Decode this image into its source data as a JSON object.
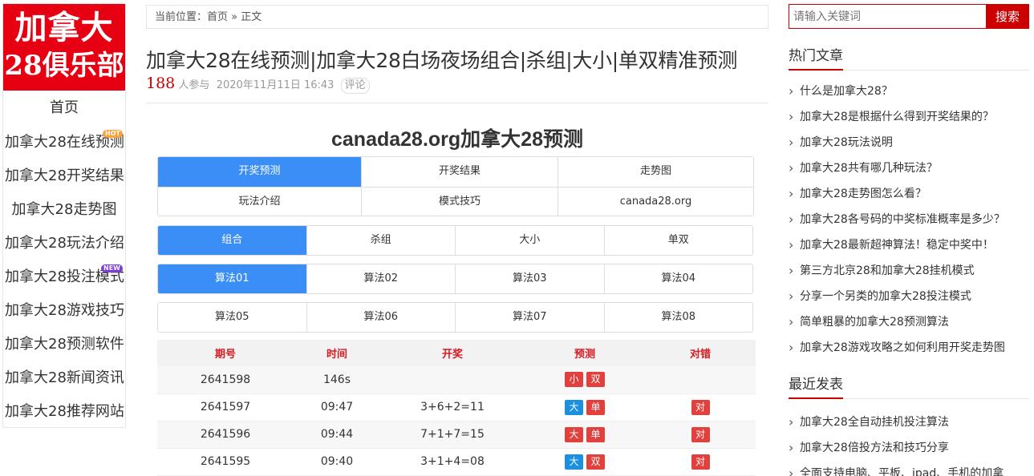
{
  "logo": {
    "line1": "加拿大",
    "line2": "28俱乐部"
  },
  "nav": {
    "items": [
      {
        "label": "首页"
      },
      {
        "label": "加拿大28在线预测",
        "badge": "HOT"
      },
      {
        "label": "加拿大28开奖结果"
      },
      {
        "label": "加拿大28走势图"
      },
      {
        "label": "加拿大28玩法介绍"
      },
      {
        "label": "加拿大28投注模式",
        "badge": "NEW"
      },
      {
        "label": "加拿大28游戏技巧"
      },
      {
        "label": "加拿大28预测软件"
      },
      {
        "label": "加拿大28新闻资讯"
      },
      {
        "label": "加拿大28推荐网站"
      }
    ]
  },
  "breadcrumb": {
    "prefix": "当前位置：",
    "home": "首页",
    "sep": "»",
    "current": "正文"
  },
  "article": {
    "title": "加拿大28在线预测|加拿大28白场夜场组合|杀组|大小|单双精准预测",
    "views": "188",
    "views_suffix": "人参与",
    "date": "2020年11月11日 16:43",
    "comment": "评论"
  },
  "widget": {
    "title": "canada28.org加拿大28预测",
    "tabs_row1": [
      "开奖预测",
      "开奖结果",
      "走势图"
    ],
    "tabs_row2": [
      "玩法介绍",
      "模式技巧",
      "canada28.org"
    ],
    "types": [
      "组合",
      "杀组",
      "大小",
      "单双"
    ],
    "algos_row1": [
      "算法01",
      "算法02",
      "算法03",
      "算法04"
    ],
    "algos_row2": [
      "算法05",
      "算法06",
      "算法07",
      "算法08"
    ]
  },
  "table": {
    "headers": [
      "期号",
      "时间",
      "开奖",
      "预测",
      "对错"
    ],
    "rows": [
      {
        "issue": "2641598",
        "time": "146s",
        "result": "",
        "predict": [
          "小",
          "双"
        ],
        "predict_colors": [
          "red",
          "red"
        ],
        "check": ""
      },
      {
        "issue": "2641597",
        "time": "09:47",
        "result": "3+6+2=11",
        "predict": [
          "大",
          "单"
        ],
        "predict_colors": [
          "blue",
          "red"
        ],
        "check": "对"
      },
      {
        "issue": "2641596",
        "time": "09:44",
        "result": "7+1+7=15",
        "predict": [
          "大",
          "单"
        ],
        "predict_colors": [
          "red",
          "red"
        ],
        "check": "对"
      },
      {
        "issue": "2641595",
        "time": "09:40",
        "result": "3+1+4=08",
        "predict": [
          "大",
          "双"
        ],
        "predict_colors": [
          "blue",
          "red"
        ],
        "check": "对"
      }
    ]
  },
  "search": {
    "placeholder": "请输入关键词",
    "button": "搜索"
  },
  "hot": {
    "title": "热门文章",
    "items": [
      "什么是加拿大28？",
      "加拿大28是根据什么得到开奖结果的？",
      "加拿大28玩法说明",
      "加拿大28共有哪几种玩法？",
      "加拿大28走势图怎么看？",
      "加拿大28各号码的中奖标准概率是多少？",
      "加拿大28最新超神算法！稳定中奖中！",
      "第三方北京28和加拿大28挂机模式",
      "分享一个另类的加拿大28投注模式",
      "简单粗暴的加拿大28预测算法",
      "加拿大28游戏攻略之如何利用开奖走势图"
    ]
  },
  "recent": {
    "title": "最近发表",
    "items": [
      "加拿大28全自动挂机投注算法",
      "加拿大28倍投方法和技巧分享",
      "全面支持电脑、平板、ipad、手机的加拿"
    ]
  }
}
